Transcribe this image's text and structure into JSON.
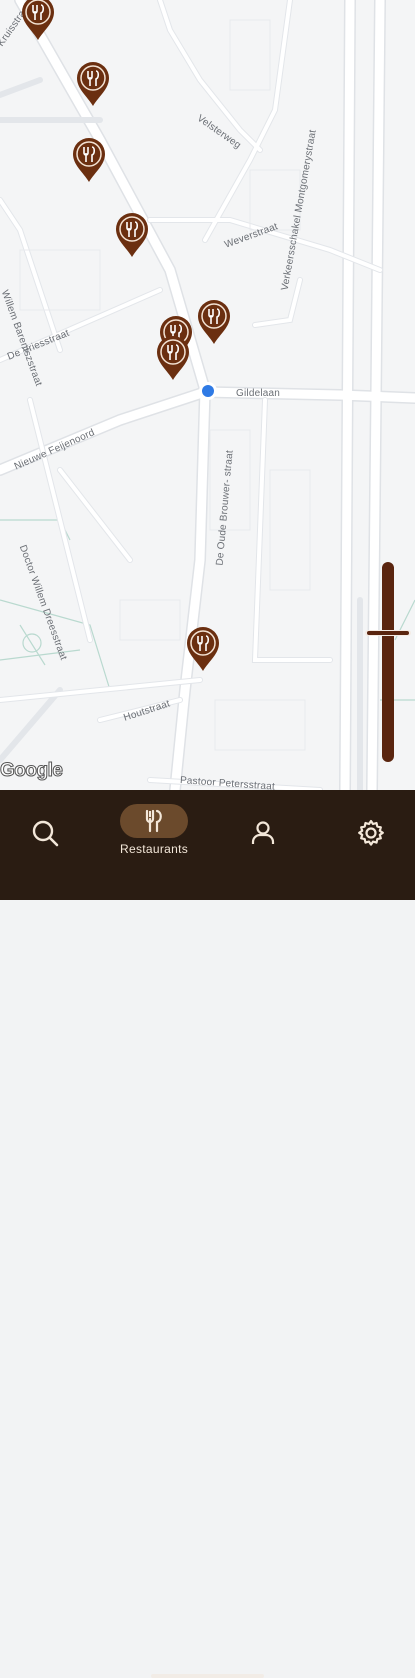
{
  "map": {
    "streets": [
      "Kruisstraat",
      "Willem Barentszstraat",
      "De Vriesstraat",
      "Nieuwe Feijenoord",
      "Doctor Willem Dreesstraat",
      "Weverstraat",
      "Gildelaan",
      "De Oude Brouwer- straat",
      "Houtstraat",
      "Pastoor Petersstraat",
      "Velsterweg",
      "Verkeersschakel Montgomerystraat"
    ],
    "attribution": "Google",
    "markers": [
      {
        "icon": "restaurant-icon"
      },
      {
        "icon": "restaurant-icon"
      },
      {
        "icon": "restaurant-icon"
      },
      {
        "icon": "restaurant-icon"
      },
      {
        "icon": "restaurant-icon"
      },
      {
        "icon": "restaurant-icon"
      },
      {
        "icon": "restaurant-icon"
      },
      {
        "icon": "restaurant-icon"
      }
    ],
    "marker_color": "#6b2f10",
    "location_dot_color": "#2f7ae5"
  },
  "nav": {
    "items": [
      {
        "icon": "search-icon",
        "label": ""
      },
      {
        "icon": "restaurant-icon",
        "label": "Restaurants",
        "active": true
      },
      {
        "icon": "profile-icon",
        "label": ""
      },
      {
        "icon": "settings-gear-icon",
        "label": ""
      }
    ],
    "background": "#2a1c12",
    "active_pill": "#6b4a2c"
  }
}
